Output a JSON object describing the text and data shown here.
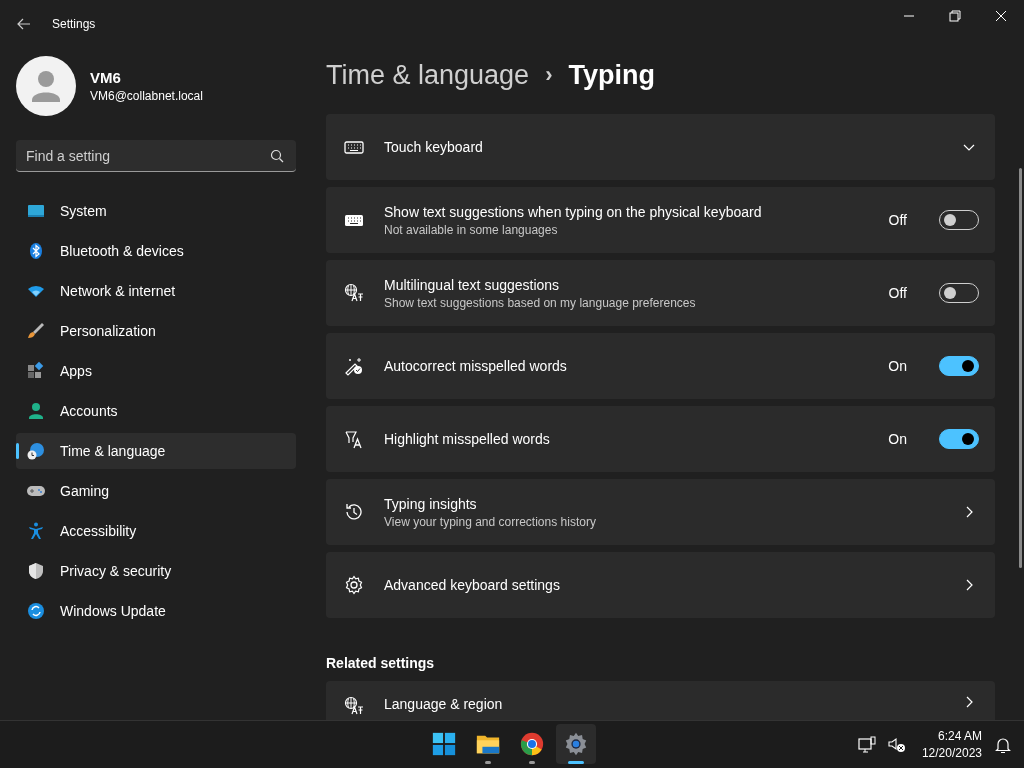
{
  "window": {
    "title": "Settings"
  },
  "user": {
    "name": "VM6",
    "email": "VM6@collabnet.local"
  },
  "search": {
    "placeholder": "Find a setting"
  },
  "sidebar": {
    "items": [
      {
        "label": "System",
        "selected": false
      },
      {
        "label": "Bluetooth & devices",
        "selected": false
      },
      {
        "label": "Network & internet",
        "selected": false
      },
      {
        "label": "Personalization",
        "selected": false
      },
      {
        "label": "Apps",
        "selected": false
      },
      {
        "label": "Accounts",
        "selected": false
      },
      {
        "label": "Time & language",
        "selected": true
      },
      {
        "label": "Gaming",
        "selected": false
      },
      {
        "label": "Accessibility",
        "selected": false
      },
      {
        "label": "Privacy & security",
        "selected": false
      },
      {
        "label": "Windows Update",
        "selected": false
      }
    ]
  },
  "breadcrumb": {
    "parent": "Time & language",
    "separator": "›",
    "current": "Typing"
  },
  "settings": [
    {
      "kind": "expander",
      "title": "Touch keyboard",
      "expanded": false
    },
    {
      "kind": "toggle",
      "title": "Show text suggestions when typing on the physical keyboard",
      "subtitle": "Not available in some languages",
      "state_label": "Off",
      "on": false
    },
    {
      "kind": "toggle",
      "title": "Multilingual text suggestions",
      "subtitle": "Show text suggestions based on my language preferences",
      "state_label": "Off",
      "on": false
    },
    {
      "kind": "toggle",
      "title": "Autocorrect misspelled words",
      "state_label": "On",
      "on": true
    },
    {
      "kind": "toggle",
      "title": "Highlight misspelled words",
      "state_label": "On",
      "on": true
    },
    {
      "kind": "link",
      "title": "Typing insights",
      "subtitle": "View your typing and corrections history"
    },
    {
      "kind": "link",
      "title": "Advanced keyboard settings"
    }
  ],
  "related": {
    "heading": "Related settings",
    "items": [
      {
        "kind": "link",
        "title": "Language & region"
      }
    ]
  },
  "taskbar": {
    "apps": [
      {
        "kind": "start",
        "running": false,
        "active": false
      },
      {
        "kind": "explorer",
        "running": true,
        "active": false
      },
      {
        "kind": "chrome",
        "running": true,
        "active": false
      },
      {
        "kind": "settings",
        "running": true,
        "active": true
      }
    ],
    "time": "6:24 AM",
    "date": "12/20/2023"
  }
}
